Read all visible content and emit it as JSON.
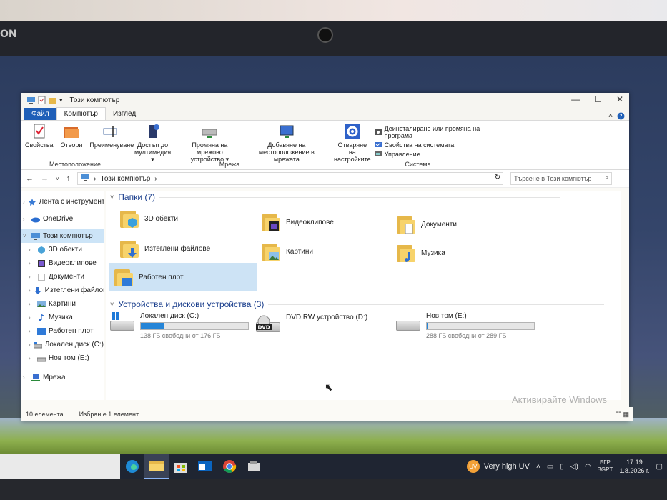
{
  "window": {
    "title": "Този компютър",
    "tabs": [
      "Файл",
      "Компютър",
      "Изглед"
    ],
    "active_tab": "Компютър"
  },
  "ribbon": {
    "location_group": {
      "label": "Местоположение",
      "buttons": [
        "Свойства",
        "Отвори",
        "Преименуване"
      ]
    },
    "network_group": {
      "label": "Мрежа",
      "buttons": [
        {
          "line1": "Достъп до",
          "line2": "мултимедия ▾"
        },
        {
          "line1": "Промяна на мрежово",
          "line2": "устройство ▾"
        },
        {
          "line1": "Добавяне на",
          "line2": "местоположение в мрежата"
        }
      ]
    },
    "system_group": {
      "label": "Система",
      "open_settings": {
        "line1": "Отваряне на",
        "line2": "настройките"
      },
      "items": [
        "Деинсталиране или промяна на програма",
        "Свойства на системата",
        "Управление"
      ]
    }
  },
  "address": {
    "path": "Този компютър",
    "search_placeholder": "Търсене в Този компютър"
  },
  "navpane": {
    "items": [
      {
        "label": "Лента с инструменти",
        "level": 1,
        "icon": "star-icon",
        "selected": false
      },
      {
        "label": "OneDrive",
        "level": 1,
        "icon": "cloud-icon",
        "selected": false
      },
      {
        "label": "Този компютър",
        "level": 1,
        "icon": "computer-icon",
        "selected": true
      },
      {
        "label": "3D обекти",
        "level": 2,
        "icon": "cube-icon",
        "selected": false
      },
      {
        "label": "Видеоклипове",
        "level": 2,
        "icon": "film-icon",
        "selected": false
      },
      {
        "label": "Документи",
        "level": 2,
        "icon": "document-icon",
        "selected": false
      },
      {
        "label": "Изтеглени файлове",
        "level": 2,
        "icon": "download-icon",
        "selected": false
      },
      {
        "label": "Картини",
        "level": 2,
        "icon": "picture-icon",
        "selected": false
      },
      {
        "label": "Музика",
        "level": 2,
        "icon": "music-icon",
        "selected": false
      },
      {
        "label": "Работен плот",
        "level": 2,
        "icon": "desktop-icon",
        "selected": false
      },
      {
        "label": "Локален диск (C:)",
        "level": 2,
        "icon": "drive-icon",
        "selected": false
      },
      {
        "label": "Нов том (E:)",
        "level": 2,
        "icon": "drive-icon",
        "selected": false
      },
      {
        "label": "Мрежа",
        "level": 1,
        "icon": "network-icon",
        "selected": false
      }
    ]
  },
  "folders_section": {
    "title": "Папки (7)",
    "items": [
      {
        "label": "3D обекти",
        "icon": "cube-icon"
      },
      {
        "label": "Видеоклипове",
        "icon": "film-icon"
      },
      {
        "label": "Документи",
        "icon": "document-icon"
      },
      {
        "label": "Изтеглени файлове",
        "icon": "download-icon"
      },
      {
        "label": "Картини",
        "icon": "picture-icon"
      },
      {
        "label": "Музика",
        "icon": "music-icon"
      },
      {
        "label": "Работен плот",
        "icon": "desktop-icon",
        "selected": true
      }
    ]
  },
  "drives_section": {
    "title": "Устройства и дискови устройства (3)",
    "items": [
      {
        "label": "Локален диск (C:)",
        "free": "138 ГБ свободни от 176 ГБ",
        "used_fraction": 0.22,
        "icon": "windows-drive-icon"
      },
      {
        "label": "DVD RW устройство (D:)",
        "free": "",
        "used_fraction": null,
        "icon": "dvd-drive-icon"
      },
      {
        "label": "Нов том (E:)",
        "free": "288 ГБ свободни от 289 ГБ",
        "used_fraction": 0.004,
        "icon": "drive-icon"
      }
    ]
  },
  "status": {
    "count": "10 елемента",
    "selected": "Избран е 1 елемент"
  },
  "watermark": {
    "text": "Активирайте Windows"
  },
  "taskbar": {
    "apps": [
      "edge-icon",
      "file-explorer-icon",
      "store-icon",
      "outlook-icon",
      "chrome-icon",
      "app-icon"
    ],
    "weather": "Very high UV",
    "weather_badge": "UV",
    "lang_top": "БГР",
    "lang_bottom": "BGPT",
    "time": "17:19",
    "date": "1.8.2026 г."
  },
  "colors": {
    "accent": "#1f5fb8",
    "selection": "#cce4f7",
    "drive_bar": "#2685d7",
    "folder": "#f7d36b"
  }
}
